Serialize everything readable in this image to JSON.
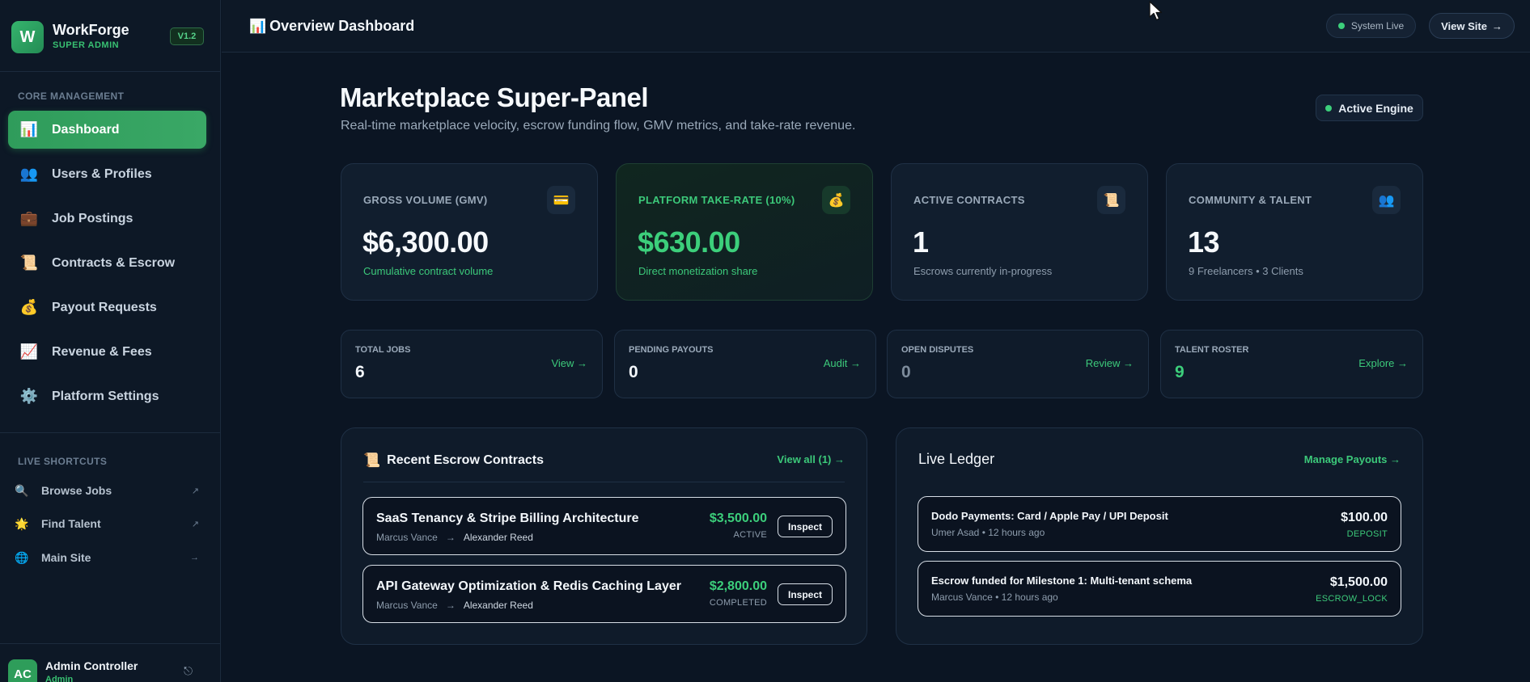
{
  "brand": {
    "logo_letter": "W",
    "name": "WorkForge",
    "role": "SUPER ADMIN",
    "version": "V1.2"
  },
  "sidebar": {
    "section_core": "CORE MANAGEMENT",
    "items": [
      {
        "label": "Dashboard",
        "icon": "bar-chart-icon",
        "glyph": "📊",
        "active": true
      },
      {
        "label": "Users & Profiles",
        "icon": "users-icon",
        "glyph": "👥"
      },
      {
        "label": "Job Postings",
        "icon": "briefcase-icon",
        "glyph": "💼"
      },
      {
        "label": "Contracts & Escrow",
        "icon": "scroll-icon",
        "glyph": "📜"
      },
      {
        "label": "Payout Requests",
        "icon": "money-bag-icon",
        "glyph": "💰"
      },
      {
        "label": "Revenue & Fees",
        "icon": "trend-chart-icon",
        "glyph": "📈"
      },
      {
        "label": "Platform Settings",
        "icon": "gear-icon",
        "glyph": "⚙️"
      }
    ],
    "section_shortcuts": "LIVE SHORTCUTS",
    "shortcuts": [
      {
        "label": "Browse Jobs",
        "icon": "magnifier-icon",
        "glyph": "🔍",
        "arrow": "↗"
      },
      {
        "label": "Find Talent",
        "icon": "star-icon",
        "glyph": "🌟",
        "arrow": "↗"
      },
      {
        "label": "Main Site",
        "icon": "globe-icon",
        "glyph": "🌐",
        "arrow": "→"
      }
    ],
    "admin": {
      "initials": "AC",
      "name": "Admin Controller",
      "role": "Admin",
      "logout_glyph": "⎋"
    }
  },
  "topbar": {
    "icon_glyph": "📊",
    "title": "Overview Dashboard",
    "status": "System Live",
    "view_site": "View Site",
    "view_site_arrow": "→"
  },
  "main": {
    "title": "Marketplace Super-Panel",
    "subtitle": "Real-time marketplace velocity, escrow funding flow, GMV metrics, and take-rate revenue.",
    "engine_status": "Active Engine",
    "stats": [
      {
        "label": "GROSS VOLUME (GMV)",
        "value": "$6,300.00",
        "note": "Cumulative contract volume",
        "icon": "credit-card-icon",
        "glyph": "💳"
      },
      {
        "label": "PLATFORM TAKE-RATE (10%)",
        "value": "$630.00",
        "note": "Direct monetization share",
        "icon": "money-bag-icon",
        "glyph": "💰"
      },
      {
        "label": "ACTIVE CONTRACTS",
        "value": "1",
        "note": "Escrows currently in-progress",
        "icon": "scroll-icon",
        "glyph": "📜"
      },
      {
        "label": "COMMUNITY & TALENT",
        "value": "13",
        "note": "9 Freelancers • 3 Clients",
        "icon": "users-icon",
        "glyph": "👥"
      }
    ],
    "mini_stats": [
      {
        "label": "TOTAL JOBS",
        "value": "6",
        "link": "View →"
      },
      {
        "label": "PENDING PAYOUTS",
        "value": "0",
        "link": "Audit →"
      },
      {
        "label": "OPEN DISPUTES",
        "value": "0",
        "link": "Review →"
      },
      {
        "label": "TALENT ROSTER",
        "value": "9",
        "link": "Explore →"
      }
    ],
    "escrow_panel": {
      "icon_glyph": "📜",
      "title": "Recent Escrow Contracts",
      "link": "View all (1) →",
      "rows": [
        {
          "title": "SaaS Tenancy & Stripe Billing Architecture",
          "from": "Marcus Vance",
          "arrow": "→",
          "to": "Alexander Reed",
          "amount": "$3,500.00",
          "status": "ACTIVE",
          "action": "Inspect"
        },
        {
          "title": "API Gateway Optimization & Redis Caching Layer",
          "from": "Marcus Vance",
          "arrow": "→",
          "to": "Alexander Reed",
          "amount": "$2,800.00",
          "status": "COMPLETED",
          "action": "Inspect"
        }
      ]
    },
    "ledger_panel": {
      "title": "Live Ledger",
      "link": "Manage Payouts →",
      "rows": [
        {
          "title": "Dodo Payments: Card / Apple Pay / UPI Deposit",
          "meta": "Umer Asad • 12 hours ago",
          "amount": "$100.00",
          "tag": "DEPOSIT"
        },
        {
          "title": "Escrow funded for Milestone 1: Multi-tenant schema",
          "meta": "Marcus Vance • 12 hours ago",
          "amount": "$1,500.00",
          "tag": "ESCROW_LOCK"
        }
      ]
    }
  },
  "colors": {
    "accent": "#3ccf7b",
    "background": "#0b1523",
    "panel": "#0f1b2a"
  }
}
